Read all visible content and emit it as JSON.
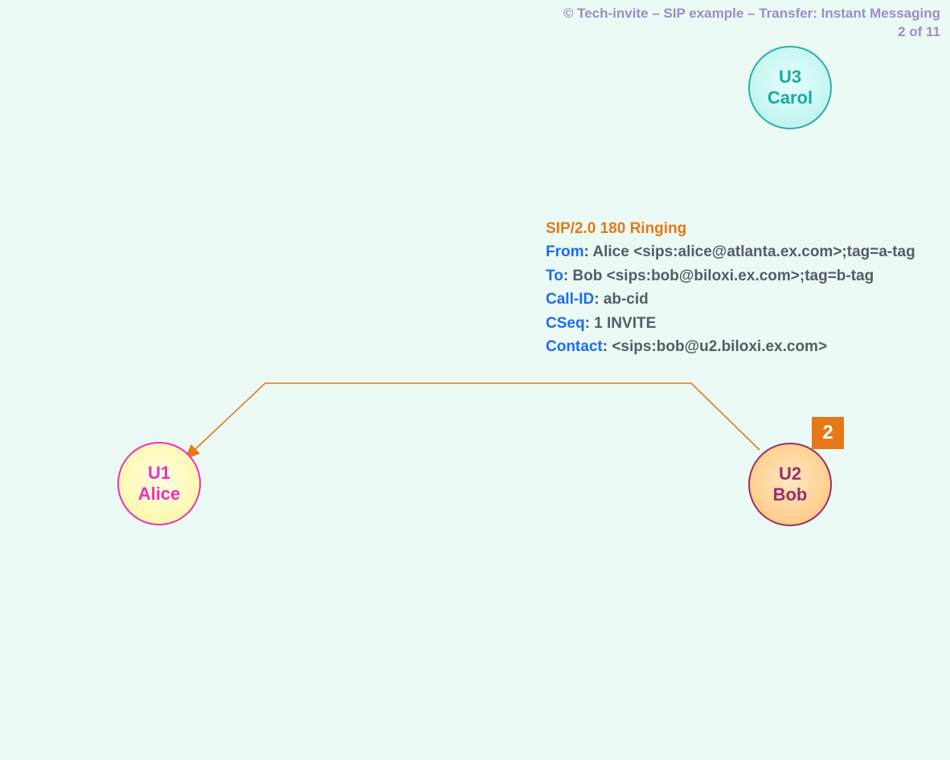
{
  "header": {
    "copyright": "© Tech-invite – SIP example – Transfer: Instant Messaging",
    "page_indicator": "2 of 11"
  },
  "nodes": {
    "carol": {
      "id": "U3",
      "name": "Carol"
    },
    "alice": {
      "id": "U1",
      "name": "Alice"
    },
    "bob": {
      "id": "U2",
      "name": "Bob"
    }
  },
  "step": {
    "number": "2"
  },
  "message": {
    "status_line": "SIP/2.0 180 Ringing",
    "headers": [
      {
        "name": "From",
        "value": ": Alice <sips:alice@atlanta.ex.com>;tag=a-tag"
      },
      {
        "name": "To",
        "value": ": Bob <sips:bob@biloxi.ex.com>;tag=b-tag"
      },
      {
        "name": "Call-ID",
        "value": ": ab-cid"
      },
      {
        "name": "CSeq",
        "value": ": 1 INVITE"
      },
      {
        "name": "Contact",
        "value": ": <sips:bob@u2.biloxi.ex.com>"
      }
    ]
  },
  "flow": {
    "from": "bob",
    "to": "alice",
    "color": "#e77817"
  }
}
